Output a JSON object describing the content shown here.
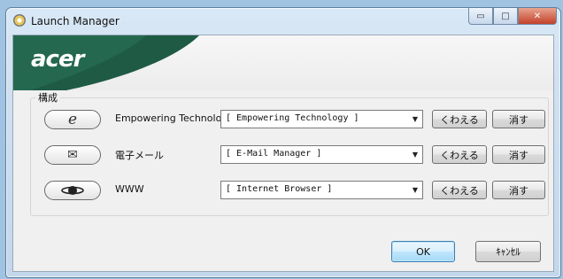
{
  "window": {
    "title": "Launch Manager",
    "minimize_symbol": "▭",
    "maximize_symbol": "□",
    "close_symbol": "✕"
  },
  "banner": {
    "logo": "acer",
    "accent_color": "#1f5a45"
  },
  "group": {
    "label": "構成",
    "rows": [
      {
        "icon": "e-icon",
        "icon_glyph": "e",
        "label": "Empowering Technology",
        "selected": "[ Empowering Technology ]",
        "sort_label": "くわえる",
        "delete_label": "消す"
      },
      {
        "icon": "mail-icon",
        "icon_glyph": "✉",
        "label": "電子メール",
        "selected": "[ E-Mail Manager ]",
        "sort_label": "くわえる",
        "delete_label": "消す"
      },
      {
        "icon": "browser-icon",
        "icon_glyph": "",
        "label": "WWW",
        "selected": "[ Internet Browser ]",
        "sort_label": "くわえる",
        "delete_label": "消す"
      }
    ]
  },
  "footer": {
    "ok_label": "OK",
    "cancel_label": "ｷｬﾝｾﾙ"
  }
}
